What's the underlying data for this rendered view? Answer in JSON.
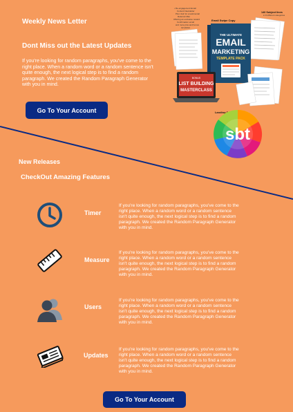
{
  "header": {
    "title": "Weekly News Letter",
    "headline": "Dont Miss out the Latest Updates",
    "intro": "If you're looking for random paragraphs, you've come to the right place. When a random word or a random sentence isn't quite enough, the next logical step is to find a random paragraph. We created the Random Paragraph Generator with you in mind.",
    "cta_label": "Go To Your Account"
  },
  "ebook": {
    "title_line1": "THE ULTIMATE",
    "title_line2": "EMAIL",
    "title_line3": "MARKETING",
    "title_line4": "TEMPLATE PACK",
    "course_label1": "BONUS",
    "course_label2": "LIST BUILDING",
    "course_label3": "MASTERCLASS",
    "label_swipe": "Email Swipe Copy",
    "label_subject": "140 Subject lines",
    "label_subject_sub": "in 8 different categories",
    "label_landing": "Landing Page templates",
    "note_lines": [
      "• Re-engagement Email",
      "Content Newsletter",
      "Plus 'Ask' for a testimonial",
      "Referral Offer",
      "Offering an exclusive reward",
      "Confirmation email",
      "and more plus and bonus",
      "templates"
    ]
  },
  "logo": {
    "text": "sbt"
  },
  "sections": {
    "new_releases": "New Releases",
    "checkout": "CheckOut Amazing Features"
  },
  "features": [
    {
      "title": "Timer",
      "icon": "clock-icon",
      "text": "If you're looking for random paragraphs, you've come to the right place. When a random word or a random sentence isn't quite enough, the next logical step is to find a random paragraph. We created the Random Paragraph Generator with you in mind."
    },
    {
      "title": "Measure",
      "icon": "ruler-icon",
      "text": "If you're looking for random paragraphs, you've come to the right place. When a random word or a random sentence isn't quite enough, the next logical step is to find a random paragraph. We created the Random Paragraph Generator with you in mind."
    },
    {
      "title": "Users",
      "icon": "users-icon",
      "text": "If you're looking for random paragraphs, you've come to the right place. When a random word or a random sentence isn't quite enough, the next logical step is to find a random paragraph. We created the Random Paragraph Generator with you in mind."
    },
    {
      "title": "Updates",
      "icon": "newspaper-icon",
      "text": "If you're looking for random paragraphs, you've come to the right place. When a random word or a random sentence isn't quite enough, the next logical step is to find a random paragraph. We created the Random Paragraph Generator with you in mind."
    }
  ],
  "footer": {
    "cta_label": "Go To Your Account"
  },
  "colors": {
    "background": "#f69a5c",
    "button": "#0a2a84",
    "divider": "#0a2a84",
    "icon": "#1f4e79"
  }
}
